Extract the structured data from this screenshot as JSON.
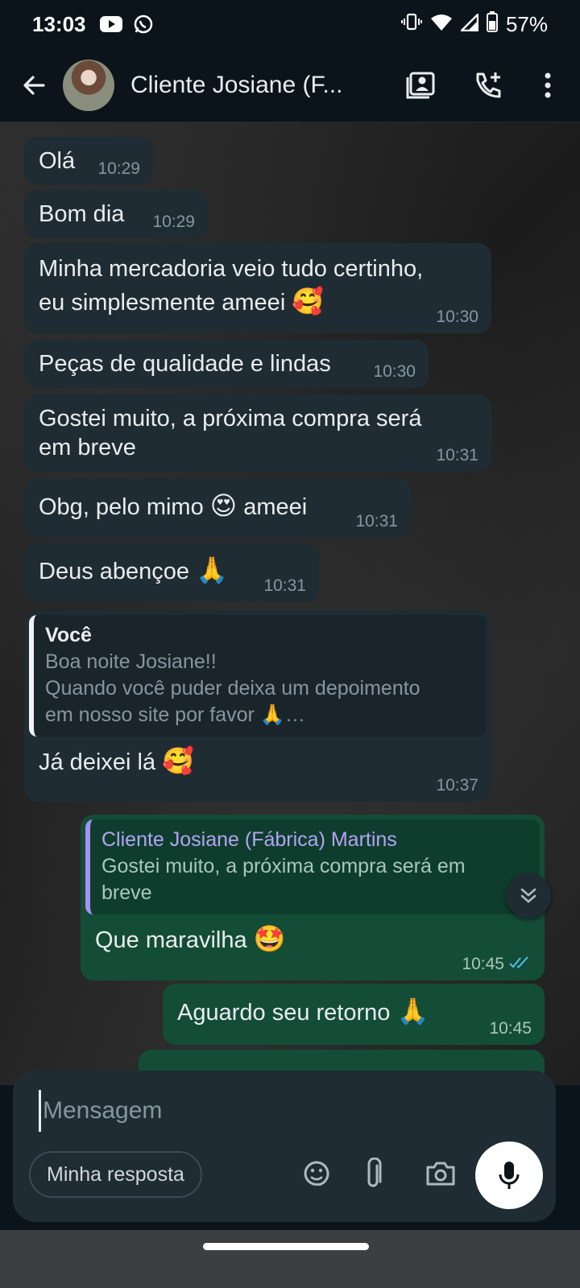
{
  "status_bar": {
    "time": "13:03",
    "battery": "57%",
    "icons": [
      "youtube-icon",
      "whatsapp-icon",
      "vibrate-icon",
      "wifi-icon",
      "signal-icon",
      "battery-icon"
    ]
  },
  "header": {
    "title": "Cliente Josiane (F...",
    "icons": [
      "back-arrow-icon",
      "contact-card-icon",
      "add-call-icon",
      "more-vert-icon"
    ]
  },
  "messages": [
    {
      "dir": "in",
      "text": "Olá",
      "time": "10:29"
    },
    {
      "dir": "in",
      "text": "Bom dia",
      "time": "10:29"
    },
    {
      "dir": "in",
      "text_line1": "Minha mercadoria veio tudo certinho,",
      "text_line2": "eu simplesmente ameei",
      "emoji": "🥰",
      "time": "10:30"
    },
    {
      "dir": "in",
      "text": "Peças de qualidade e lindas",
      "time": "10:30"
    },
    {
      "dir": "in",
      "text_line1": "Gostei muito, a próxima compra será",
      "text_line2": "em breve",
      "time": "10:31"
    },
    {
      "dir": "in",
      "text_before": "Obg, pelo mimo",
      "emoji": "😍",
      "text_after": "ameei",
      "time": "10:31"
    },
    {
      "dir": "in",
      "text": "Deus abençoe",
      "emoji": "🙏",
      "time": "10:31"
    },
    {
      "dir": "in",
      "quote_author": "Você",
      "quote_line1": "Boa noite Josiane!!",
      "quote_line2": "Quando você puder deixa um depoimento",
      "quote_line3": "em nosso site por favor 🙏…",
      "text": "Já deixei lá",
      "emoji": "🥰",
      "time": "10:37"
    },
    {
      "dir": "out",
      "quote_author": "Cliente Josiane (Fábrica) Martins",
      "quote_line1": "Gostei muito, a próxima compra será em",
      "quote_line2": "breve",
      "text": "Que maravilha",
      "emoji": "🤩",
      "time": "10:45"
    },
    {
      "dir": "out",
      "text": "Aguardo seu retorno",
      "emoji": "🙏",
      "time": "10:45"
    }
  ],
  "composer": {
    "placeholder": "Mensagem",
    "chip": "Minha resposta",
    "icons": [
      "sticker-icon",
      "attach-icon",
      "camera-icon",
      "mic-icon"
    ]
  },
  "colors": {
    "incoming": "#1f2c33",
    "outgoing": "#144d37",
    "read_ticks": "#53bdeb"
  }
}
